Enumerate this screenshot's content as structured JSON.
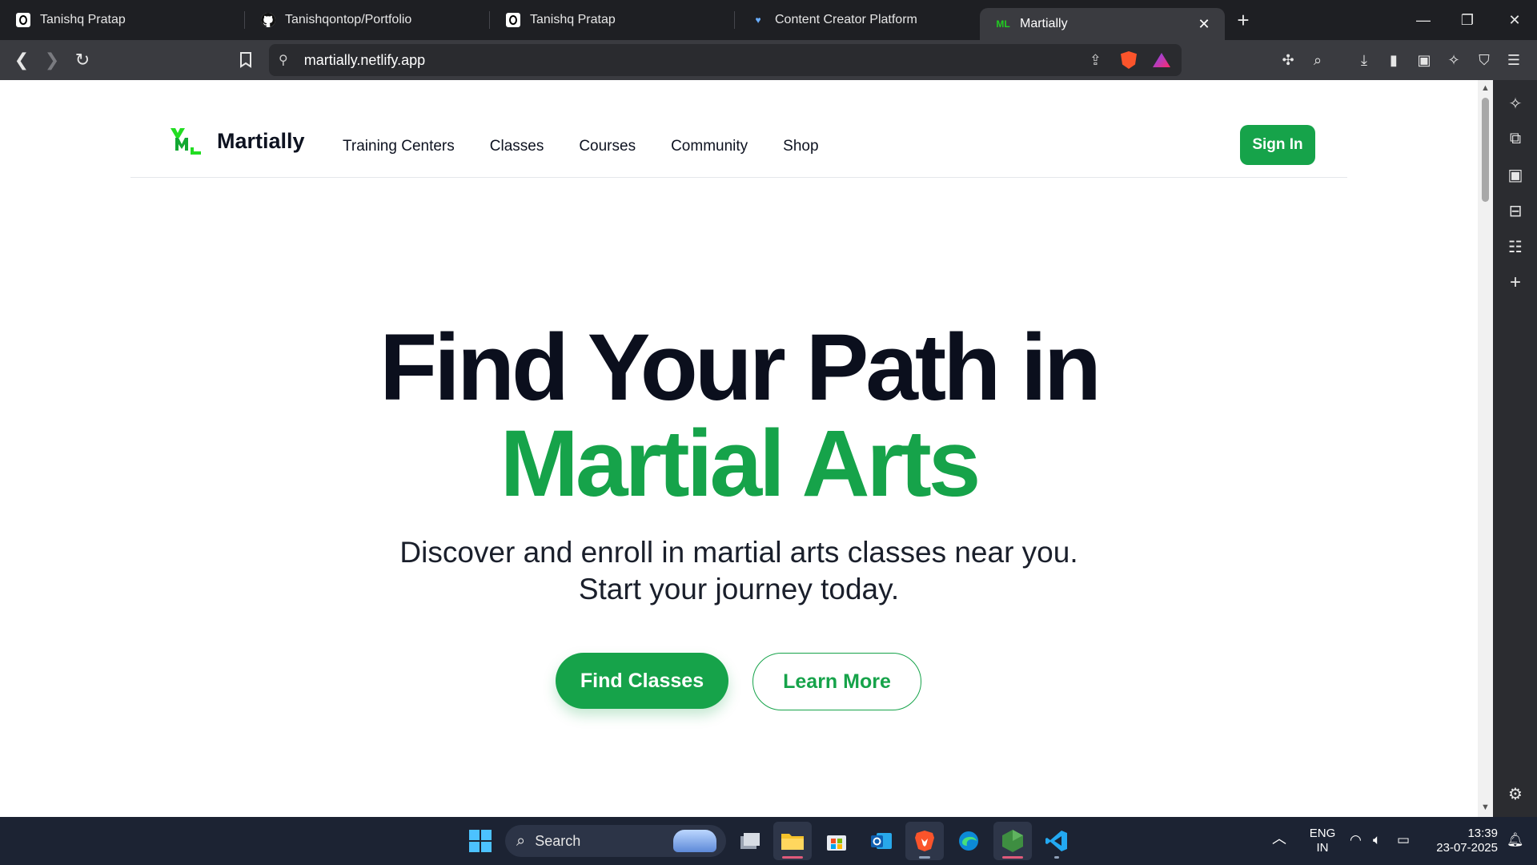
{
  "browser": {
    "tabs": [
      {
        "title": "Tanishq Pratap",
        "favicon": "opera-o-icon",
        "active": false
      },
      {
        "title": "Tanishqontop/Portfolio",
        "favicon": "github-icon",
        "active": false
      },
      {
        "title": "Tanishq Pratap",
        "favicon": "opera-o-icon",
        "active": false
      },
      {
        "title": "Content Creator Platform",
        "favicon": "heart-icon",
        "active": false
      },
      {
        "title": "Martially",
        "favicon": "martially-logo-icon",
        "active": true
      }
    ],
    "url": "martially.netlify.app"
  },
  "site": {
    "brand": "Martially",
    "nav": [
      "Training Centers",
      "Classes",
      "Courses",
      "Community",
      "Shop"
    ],
    "signin_label": "Sign In",
    "hero": {
      "title_line1": "Find Your Path in",
      "title_line2": "Martial Arts",
      "subtitle": "Discover and enroll in martial arts classes near you. Start your journey today.",
      "primary_cta": "Find Classes",
      "secondary_cta": "Learn More"
    },
    "colors": {
      "accent": "#16a34a",
      "text": "#0b0f1d"
    }
  },
  "taskbar": {
    "search_label": "Search",
    "language": "ENG",
    "region": "IN",
    "time": "13:39",
    "date": "23-07-2025"
  }
}
